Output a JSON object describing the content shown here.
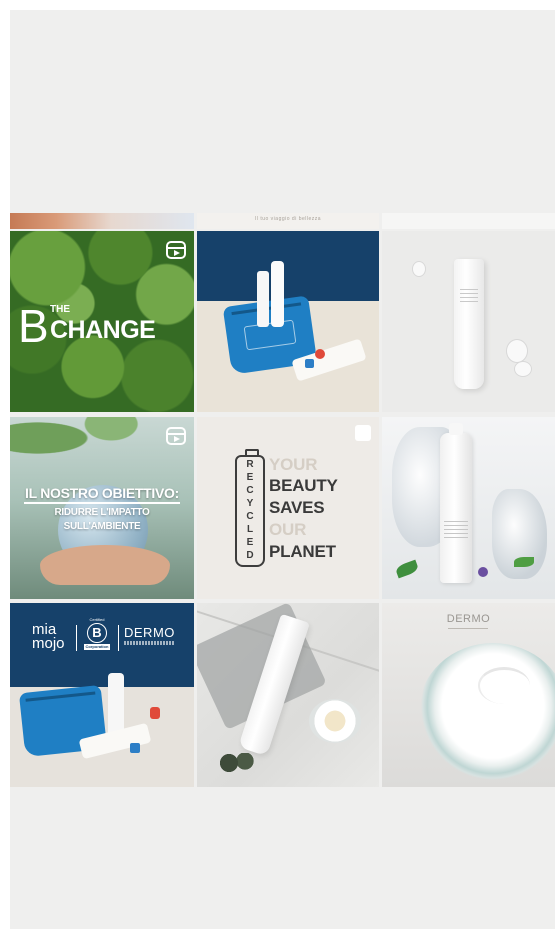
{
  "feed": {
    "top_strip_caption": "Il tuo viaggio di bellezza",
    "tiles": [
      {
        "id": "the-change",
        "overlay_b": "B",
        "overlay_the": "THE",
        "overlay_change": "CHANGE",
        "type": "reel"
      },
      {
        "id": "blue-kit",
        "type": "post"
      },
      {
        "id": "white-tube",
        "type": "post"
      },
      {
        "id": "nostro-obiettivo",
        "line1": "IL NOSTRO OBIETTIVO:",
        "line2": "RIDURRE L'IMPATTO",
        "line3": "SULL'AMBIENTE",
        "type": "reel"
      },
      {
        "id": "beauty-planet",
        "words": [
          "YOUR",
          "BEAUTY",
          "SAVES",
          "OUR",
          "PLANET"
        ],
        "recycle_letters": [
          "R",
          "E",
          "C",
          "Y",
          "C",
          "L",
          "E",
          "D"
        ],
        "type": "carousel"
      },
      {
        "id": "ice-bottle",
        "type": "post"
      },
      {
        "id": "mia-mojo-bcorp",
        "brand1": "mia\nmojo",
        "bcorp_cert": "Certified",
        "bcorp_letter": "B",
        "bcorp_corp": "Corporation",
        "brand2": "DERMO",
        "type": "post"
      },
      {
        "id": "marble-tube",
        "type": "post"
      },
      {
        "id": "cream-dish",
        "brand": "DERMO",
        "type": "post"
      }
    ]
  }
}
